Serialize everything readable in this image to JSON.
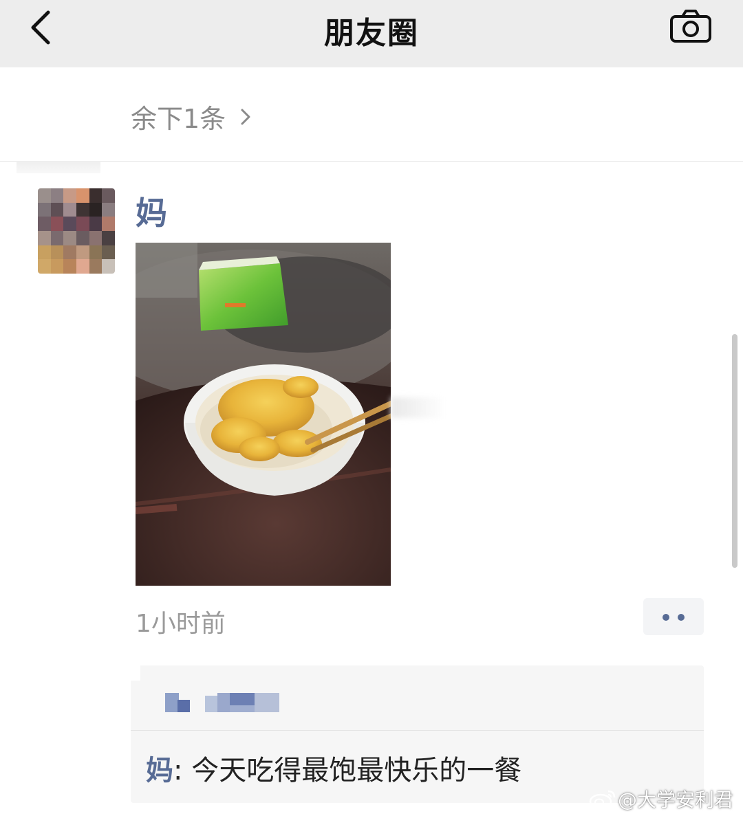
{
  "navbar": {
    "title": "朋友圈",
    "back_icon": "chevron-left-icon",
    "camera_icon": "camera-icon"
  },
  "feed": {
    "remaining_label": "余下1条",
    "remaining_icon": "chevron-right-icon"
  },
  "post": {
    "author": "妈",
    "photo": "bowl of noodles with scrambled egg and chopsticks on a dark round table",
    "time": "1小时前",
    "more_icon": "two-dots-icon"
  },
  "interactions": {
    "likes_icon": "pixelated-liker-names",
    "comment": {
      "author": "妈",
      "separator": ": ",
      "text": "今天吃得最饱最快乐的一餐"
    }
  },
  "watermark": {
    "text": "@大学安利君",
    "icon": "weibo-logo-icon"
  },
  "colors": {
    "link_blue": "#576b95",
    "navbar_bg": "#ededed",
    "comment_bg": "#f6f6f6",
    "meta_gray": "#9a9a9a"
  }
}
